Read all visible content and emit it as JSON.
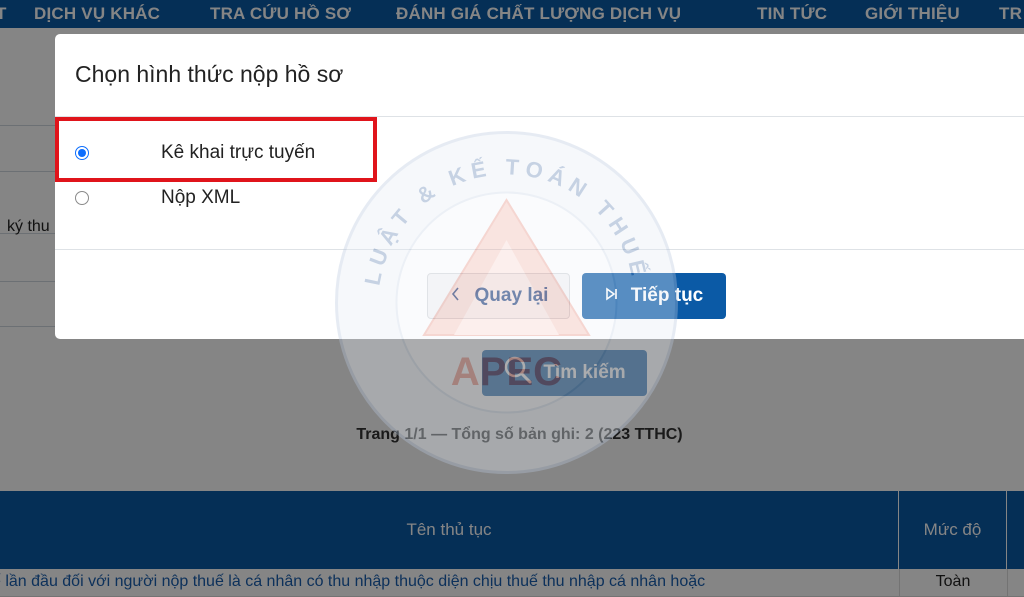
{
  "nav": {
    "items": [
      "T",
      "DỊCH VỤ KHÁC",
      "TRA CỨU HỒ SƠ",
      "ĐÁNH GIÁ CHẤT LƯỢNG DỊCH VỤ",
      "TIN TỨC",
      "GIỚI THIỆU",
      "TR"
    ]
  },
  "background": {
    "row_text": "ký thu",
    "search_label": "Tìm kiếm",
    "pager": "Trang 1/1 — Tổng số bản ghi: 2 (223 TTHC)",
    "table": {
      "headers": [
        "Tên thủ tục",
        "Mức độ"
      ],
      "row": [
        "ế lần đầu đối với người nộp thuế là cá nhân có thu nhập thuộc diện chịu thuế thu nhập cá nhân hoặc",
        "Toàn"
      ]
    }
  },
  "modal": {
    "title": "Chọn hình thức nộp hồ sơ",
    "options": [
      {
        "label": "Kê khai trực tuyến",
        "selected": true
      },
      {
        "label": "Nộp XML",
        "selected": false
      }
    ],
    "back_label": "Quay lại",
    "next_label": "Tiếp tục"
  },
  "watermark": {
    "ring_text": "LUẬT & KẾ TOÁN THUẾ APEC",
    "center_text": "APEC"
  },
  "colors": {
    "primary": "#0b5aa6",
    "highlight": "#e0141b",
    "radio": "#0d6efd"
  }
}
